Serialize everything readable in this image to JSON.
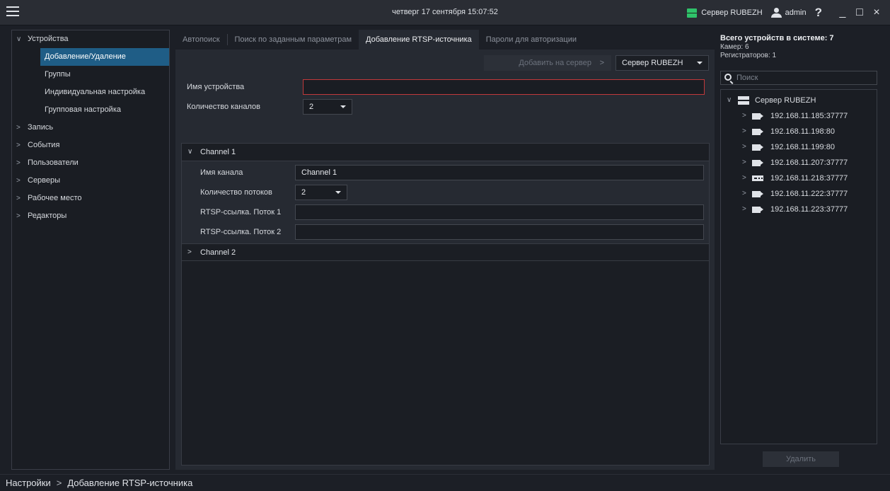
{
  "titlebar": {
    "datetime": "четверг 17 сентября 15:07:52",
    "server": "Сервер RUBEZH",
    "user": "admin",
    "help": "?",
    "min": "_",
    "max": "□",
    "close": "×"
  },
  "sidebar": {
    "items": [
      {
        "label": "Устройства",
        "chev": "∨"
      },
      {
        "label": "Добавление/Удаление"
      },
      {
        "label": "Группы"
      },
      {
        "label": "Индивидуальная настройка"
      },
      {
        "label": "Групповая настройка"
      },
      {
        "label": "Запись",
        "chev": ">"
      },
      {
        "label": "События",
        "chev": ">"
      },
      {
        "label": "Пользователи",
        "chev": ">"
      },
      {
        "label": "Серверы",
        "chev": ">"
      },
      {
        "label": "Рабочее место",
        "chev": ">"
      },
      {
        "label": "Редакторы",
        "chev": ">"
      }
    ]
  },
  "tabs": [
    {
      "label": "Автопоиск"
    },
    {
      "label": "Поиск по заданным параметрам"
    },
    {
      "label": "Добавление RTSP-источника",
      "active": true
    },
    {
      "label": "Пароли для авторизации"
    }
  ],
  "toolbar": {
    "add_label": "Добавить на сервер",
    "add_arrow": ">",
    "server_select": "Сервер RUBEZH"
  },
  "form": {
    "device_name_label": "Имя устройства",
    "device_name_value": "",
    "channels_count_label": "Количество каналов",
    "channels_count_value": "2"
  },
  "channels": [
    {
      "title": "Channel 1",
      "chev": "∨",
      "name_label": "Имя канала",
      "name_value": "Channel 1",
      "streams_label": "Количество потоков",
      "streams_value": "2",
      "rtsp1_label": "RTSP-ссылка. Поток 1",
      "rtsp1_value": "",
      "rtsp2_label": "RTSP-ссылка. Поток 2",
      "rtsp2_value": ""
    },
    {
      "title": "Channel 2",
      "chev": ">"
    }
  ],
  "summary": {
    "total": "Всего устройств в системе: 7",
    "cameras": "Камер: 6",
    "recorders": "Регистраторов: 1"
  },
  "search": {
    "placeholder": "Поиск"
  },
  "tree": {
    "root": {
      "label": "Сервер RUBEZH",
      "chev": "∨"
    },
    "devices": [
      {
        "label": "192.168.11.185:37777",
        "icon": "camera-icon",
        "chev": ">"
      },
      {
        "label": "192.168.11.198:80",
        "icon": "camera-icon",
        "chev": ">"
      },
      {
        "label": "192.168.11.199:80",
        "icon": "camera-icon",
        "chev": ">"
      },
      {
        "label": "192.168.11.207:37777",
        "icon": "camera-icon",
        "chev": ">"
      },
      {
        "label": "192.168.11.218:37777",
        "icon": "recorder-icon",
        "chev": ">"
      },
      {
        "label": "192.168.11.222:37777",
        "icon": "camera-icon",
        "chev": ">"
      },
      {
        "label": "192.168.11.223:37777",
        "icon": "camera-icon",
        "chev": ">"
      }
    ]
  },
  "delete_label": "Удалить",
  "breadcrumb": {
    "root": "Настройки",
    "sep": ">",
    "current": "Добавление RTSP-источника"
  },
  "colors": {
    "accent": "#1f5d86",
    "server_status": "#2fc26a",
    "error_border": "#c0393b"
  }
}
